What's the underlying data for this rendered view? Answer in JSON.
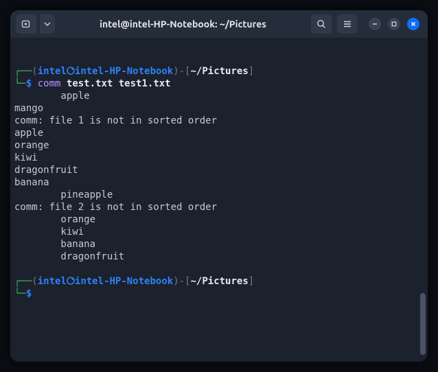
{
  "titlebar": {
    "title": "intel@intel-HP-Notebook: ~/Pictures"
  },
  "prompt": {
    "user": "intel",
    "host": "intel-HP-Notebook",
    "path": "~/Pictures",
    "symbol": "$"
  },
  "command": {
    "name": "comm",
    "args": "test.txt test1.txt"
  },
  "output": [
    {
      "indent": 2,
      "text": "apple"
    },
    {
      "indent": 0,
      "text": "mango"
    },
    {
      "indent": 0,
      "text": "comm: file 1 is not in sorted order"
    },
    {
      "indent": 0,
      "text": "apple"
    },
    {
      "indent": 0,
      "text": "orange"
    },
    {
      "indent": 0,
      "text": "kiwi"
    },
    {
      "indent": 0,
      "text": "dragonfruit"
    },
    {
      "indent": 0,
      "text": "banana"
    },
    {
      "indent": 2,
      "text": "pineapple"
    },
    {
      "indent": 0,
      "text": "comm: file 2 is not in sorted order"
    },
    {
      "indent": 2,
      "text": "orange"
    },
    {
      "indent": 2,
      "text": "kiwi"
    },
    {
      "indent": 2,
      "text": "banana"
    },
    {
      "indent": 2,
      "text": "dragonfruit"
    }
  ]
}
